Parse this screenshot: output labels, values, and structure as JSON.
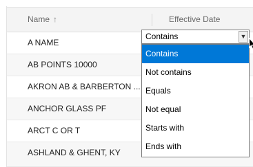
{
  "header": {
    "name_label": "Name",
    "sort_icon": "arrow-up",
    "date_label": "Effective Date"
  },
  "rows": [
    {
      "name": "A NAME"
    },
    {
      "name": "AB POINTS 10000"
    },
    {
      "name": "AKRON AB & BARBERTON ..."
    },
    {
      "name": "ANCHOR GLASS PF"
    },
    {
      "name": "ARCT C OR T"
    },
    {
      "name": "ASHLAND & GHENT, KY"
    }
  ],
  "filter": {
    "selected": "Contains",
    "options": [
      "Contains",
      "Not contains",
      "Equals",
      "Not equal",
      "Starts with",
      "Ends with"
    ]
  },
  "colors": {
    "selection": "#0078d7",
    "header_bg": "#f4f4f4",
    "alt_row_bg": "#f7f7f7"
  }
}
